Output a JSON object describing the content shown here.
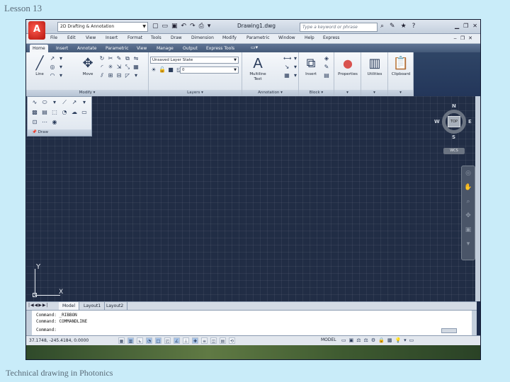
{
  "slide": {
    "title": "Lesson 13",
    "footer": "Technical drawing in Photonics"
  },
  "app": {
    "logo": "A",
    "workspace": "2D Drafting & Annotation",
    "doc_title": "Drawing1.dwg",
    "search_placeholder": "Type a keyword or phrase"
  },
  "menubar": [
    "File",
    "Edit",
    "View",
    "Insert",
    "Format",
    "Tools",
    "Draw",
    "Dimension",
    "Modify",
    "Parametric",
    "Window",
    "Help",
    "Express"
  ],
  "ribbon_tabs": [
    {
      "label": "Home",
      "active": true
    },
    {
      "label": "Insert"
    },
    {
      "label": "Annotate"
    },
    {
      "label": "Parametric"
    },
    {
      "label": "View"
    },
    {
      "label": "Manage"
    },
    {
      "label": "Output"
    },
    {
      "label": "Express Tools"
    }
  ],
  "ribbon": {
    "line_label": "Line",
    "move_label": "Move",
    "modify_panel": "Modify",
    "layers_panel": "Layers",
    "layer_state": "Unsaved Layer State",
    "current_layer": "0",
    "mtext_label": "Multiline Text",
    "annotation_panel": "Annotation",
    "insert_label": "Insert",
    "block_panel": "Block",
    "properties_label": "Properties",
    "utilities_label": "Utilities",
    "clipboard_label": "Clipboard",
    "draw_panel": "Draw"
  },
  "viewcube": {
    "n": "N",
    "s": "S",
    "e": "E",
    "w": "W",
    "top": "TOP",
    "wcs": "WCS"
  },
  "ucs": {
    "y": "Y",
    "x": "X"
  },
  "layout_tabs": [
    {
      "label": "Model",
      "active": true
    },
    {
      "label": "Layout1"
    },
    {
      "label": "Layout2"
    }
  ],
  "command_line": [
    "Command: _RIBBON",
    "Command: COMMANDLINE",
    "Command:"
  ],
  "status": {
    "coords": "37.1748, -245.4184, 0.0000",
    "model": "MODEL"
  }
}
